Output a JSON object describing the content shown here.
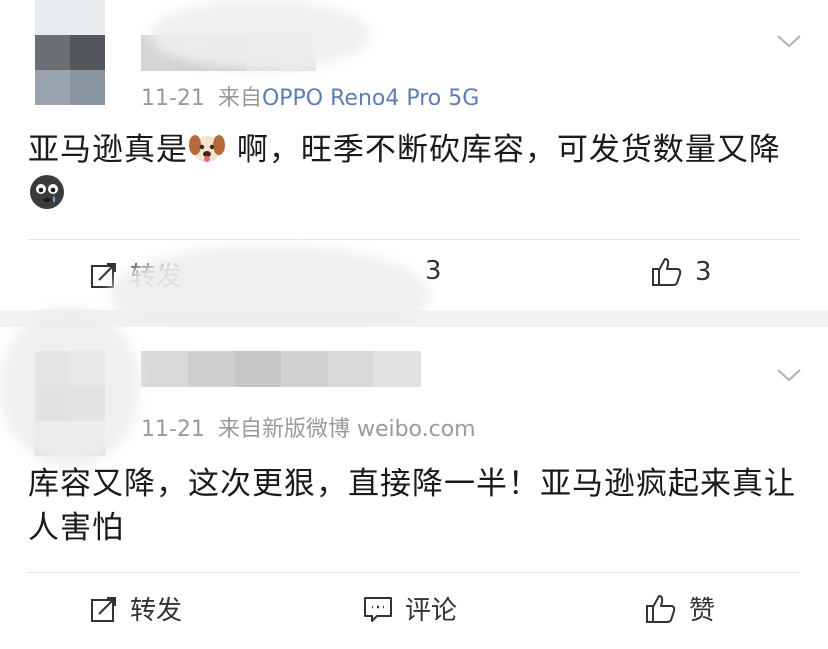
{
  "posts": [
    {
      "date": "11-21",
      "source_prefix": "来自",
      "source": "OPPO Reno4 Pro 5G",
      "text_before_emoji": "亚马逊真是",
      "text_after_emoji": " 啊，旺季不断砍库容，可发货数量又降",
      "emoji1": "dog-face",
      "emoji2": "crying-face",
      "actions": {
        "repost": "转发",
        "comment": "3",
        "like": "3"
      }
    },
    {
      "date": "11-21",
      "source_prefix": "来自",
      "source": "新版微博 weibo.com",
      "text": "库容又降，这次更狠，直接降一半！亚马逊疯起来真让人害怕",
      "actions": {
        "repost": "转发",
        "comment": "评论",
        "like": "赞"
      }
    }
  ],
  "icons": {
    "repost": "repost-icon",
    "comment": "comment-icon",
    "like": "thumbs-up-icon",
    "expand": "chevron-down-icon"
  },
  "colors": {
    "source_link": "#5b7fb2",
    "meta_gray": "#9a9a9a",
    "text": "#1a1a1a",
    "page_bg": "#f2f2f2"
  }
}
